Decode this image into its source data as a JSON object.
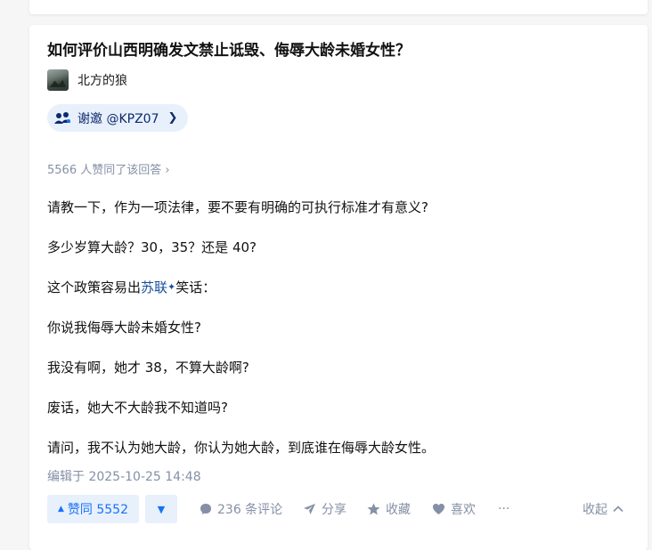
{
  "question": {
    "title": "如何评价山西明确发文禁止诋毁、侮辱大龄未婚女性？"
  },
  "author": {
    "name": "北方的狼"
  },
  "invite": {
    "label": "谢邀 @KPZ07",
    "chevron": "❯",
    "icon": "people-group-icon"
  },
  "answer": {
    "agree_text": "5566 人赞同了该回答 ›",
    "paragraphs": {
      "p1": "请教一下，作为一项法律，要不要有明确的可执行标准才有意义?",
      "p2": "多少岁算大龄？30，35？还是 40?",
      "p3_prefix": "这个政策容易出",
      "p3_link": "苏联",
      "p3_spark": "✦",
      "p3_suffix": "笑话：",
      "p4": "你说我侮辱大龄未婚女性?",
      "p5": "我没有啊，她才 38，不算大龄啊?",
      "p6": "废话，她大不大龄我不知道吗?",
      "p7": "请问，我不认为她大龄，你认为她大龄，到底谁在侮辱大龄女性。"
    },
    "edited": "编辑于 2025-10-25 14:48"
  },
  "actions": {
    "upvote": "赞同 5552",
    "upvote_arrow": "▲",
    "downvote_arrow": "▼",
    "comments": "236 条评论",
    "share": "分享",
    "favorite": "收藏",
    "like": "喜欢",
    "more": "···",
    "collapse": "收起"
  },
  "colors": {
    "accent": "#1772f6",
    "link": "#175199",
    "muted": "#8590a6",
    "pill_bg": "#e8f0fc"
  }
}
